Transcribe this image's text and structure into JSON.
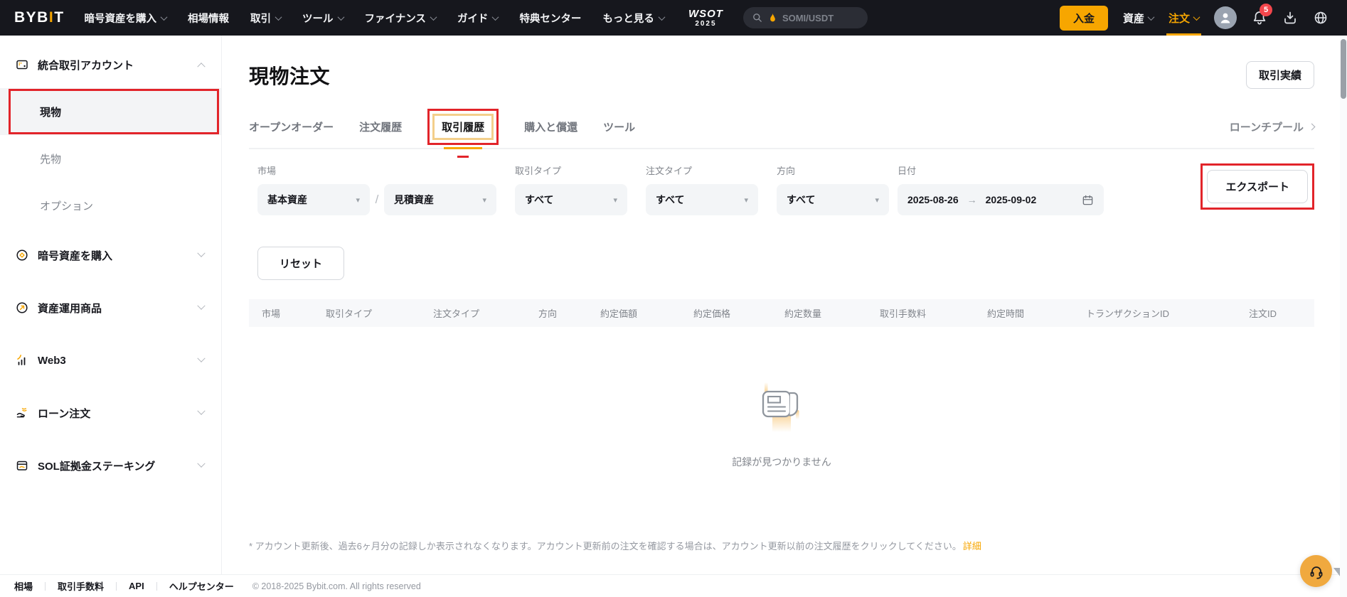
{
  "colors": {
    "accent": "#F7A600",
    "annotation_red": "#E2242A",
    "badge_red": "#F3464C",
    "topnav_bg": "#16171D"
  },
  "topnav": {
    "logo_pre": "BYB",
    "logo_i": "I",
    "logo_post": "T",
    "menu": [
      "暗号資産を購入",
      "相場情報",
      "取引",
      "ツール",
      "ファイナンス",
      "ガイド",
      "特典センター",
      "もっと見る"
    ],
    "wsot_line1": "WSOT",
    "wsot_line2": "2025",
    "search_placeholder": "SOMI/USDT",
    "deposit": "入金",
    "assets": "資産",
    "orders": "注文",
    "notification_count": "5"
  },
  "sidebar": {
    "unified_account": "統合取引アカウント",
    "sub_items": [
      "現物",
      "先物",
      "オプション"
    ],
    "items": [
      "暗号資産を購入",
      "資産運用商品",
      "Web3",
      "ローン注文",
      "SOL証拠金ステーキング"
    ]
  },
  "main": {
    "page_title": "現物注文",
    "performance_button": "取引実績",
    "tabs": [
      "オープンオーダー",
      "注文履歴",
      "取引履歴",
      "購入と償還",
      "ツール"
    ],
    "active_tab": "取引履歴",
    "launchpool_link": "ローンチプール",
    "empty_text": "記録が見つかりません",
    "note_text": "* アカウント更新後、過去6ヶ月分の記録しか表示されなくなります。アカウント更新前の注文を確認する場合は、アカウント更新以前の注文履歴をクリックしてください。",
    "note_link": "詳細"
  },
  "filters": {
    "market_label": "市場",
    "base_asset": "基本資産",
    "separator": "/",
    "quote_asset": "見積資産",
    "trade_type_label": "取引タイプ",
    "trade_type_value": "すべて",
    "order_type_label": "注文タイプ",
    "order_type_value": "すべて",
    "direction_label": "方向",
    "direction_value": "すべて",
    "date_label": "日付",
    "date_start": "2025-08-26",
    "date_arrow": "→",
    "date_end": "2025-09-02",
    "export_label": "エクスポート",
    "reset_label": "リセット"
  },
  "table": {
    "headers": [
      "市場",
      "取引タイプ",
      "注文タイプ",
      "方向",
      "約定価額",
      "約定価格",
      "約定数量",
      "取引手数料",
      "約定時間",
      "トランザクションID",
      "注文ID"
    ]
  },
  "footer": {
    "links": [
      "相場",
      "取引手数料",
      "API",
      "ヘルプセンター"
    ],
    "copyright": "© 2018-2025 Bybit.com. All rights reserved"
  }
}
